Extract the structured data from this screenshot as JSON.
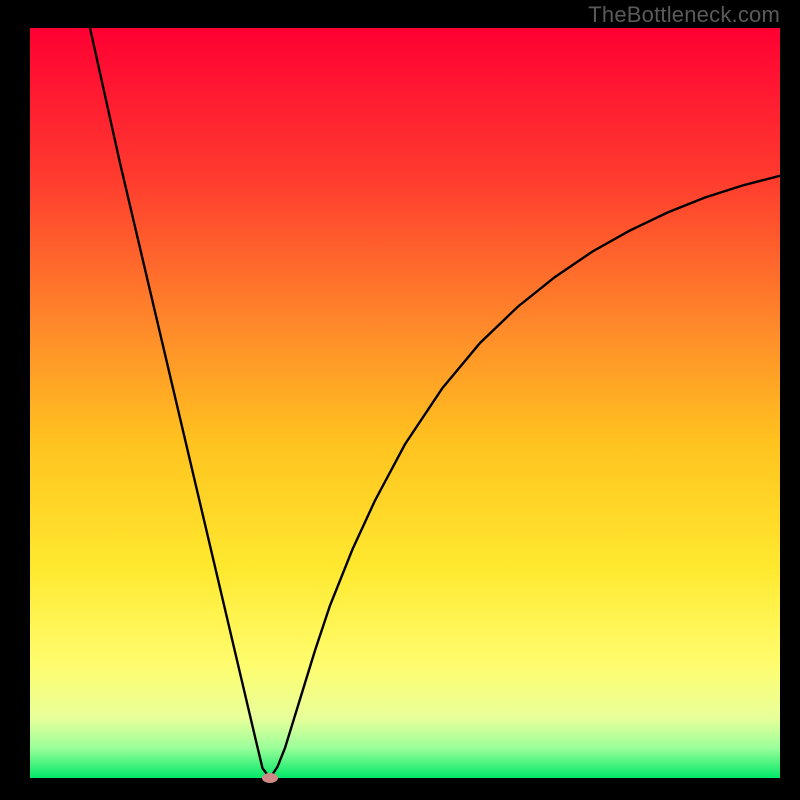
{
  "watermark": "TheBottleneck.com",
  "chart_data": {
    "type": "line",
    "title": "",
    "xlabel": "",
    "ylabel": "",
    "xlim": [
      0,
      100
    ],
    "ylim": [
      0,
      100
    ],
    "grid": false,
    "legend": false,
    "background": "vertical-gradient",
    "gradient_stops": [
      {
        "pos": 0.0,
        "color": "#ff0033"
      },
      {
        "pos": 0.2,
        "color": "#ff3b2e"
      },
      {
        "pos": 0.4,
        "color": "#ff8a2a"
      },
      {
        "pos": 0.55,
        "color": "#ffc21f"
      },
      {
        "pos": 0.72,
        "color": "#ffe92f"
      },
      {
        "pos": 0.85,
        "color": "#fffd6f"
      },
      {
        "pos": 0.92,
        "color": "#e8ff9a"
      },
      {
        "pos": 0.96,
        "color": "#9aff9a"
      },
      {
        "pos": 1.0,
        "color": "#00e868"
      }
    ],
    "series": [
      {
        "name": "bottleneck-curve",
        "color": "#000000",
        "x": [
          8,
          10,
          12,
          14,
          16,
          18,
          20,
          22,
          24,
          26,
          28,
          30,
          31,
          32,
          33,
          34,
          36,
          38,
          40,
          43,
          46,
          50,
          55,
          60,
          65,
          70,
          75,
          80,
          85,
          90,
          95,
          100
        ],
        "y": [
          100,
          91,
          82,
          73.5,
          65,
          56.5,
          48,
          39.5,
          31,
          22.5,
          14,
          5.5,
          1.3,
          0,
          1.5,
          4,
          10.5,
          17,
          23,
          30.5,
          37,
          44.5,
          52,
          58,
          62.8,
          66.8,
          70.2,
          73,
          75.4,
          77.4,
          79,
          80.3
        ]
      }
    ],
    "marker": {
      "x": 32,
      "y": 0,
      "color": "#cf8a87"
    }
  }
}
